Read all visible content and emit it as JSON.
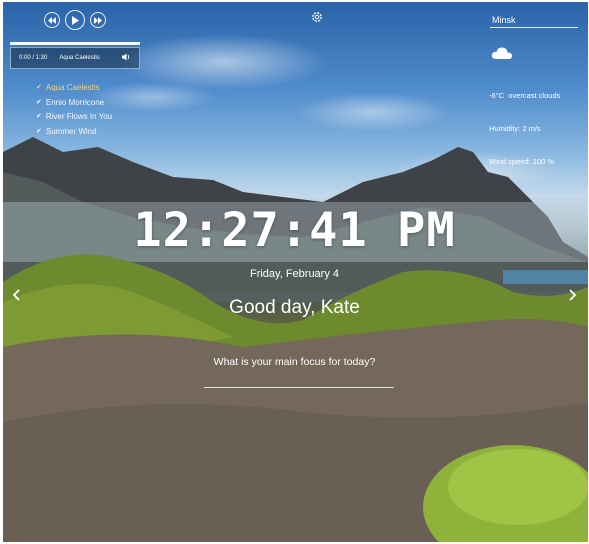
{
  "player": {
    "prev_icon": "skip-back-icon",
    "play_icon": "play-icon",
    "next_icon": "skip-forward-icon",
    "current_time": "0:00 / 1:30",
    "current_track": "Aqua Caelestis",
    "volume_icon": "volume-icon",
    "playlist": [
      {
        "title": "Aqua Caelestis",
        "icon": "play-small-icon"
      },
      {
        "title": "Ennio Morricone",
        "icon": "play-small-icon"
      },
      {
        "title": "River Flows In You",
        "icon": "play-small-icon"
      },
      {
        "title": "Summer Wind",
        "icon": "play-small-icon"
      }
    ]
  },
  "settings": {
    "icon": "gear-icon"
  },
  "weather": {
    "city": "Minsk",
    "icon": "cloud-icon",
    "description": "-6°C  overcast clouds",
    "humidity": "Humidity: 2 m/s",
    "wind": "Wind speed: 100 %"
  },
  "clock": {
    "time": "12:27:41 PM",
    "date": "Friday, February 4"
  },
  "greeting": {
    "text": "Good day,",
    "name": "Kate"
  },
  "focus": {
    "label": "What is your main focus for today?",
    "value": ""
  },
  "slider": {
    "prev_icon": "chevron-left-icon",
    "next_icon": "chevron-right-icon"
  }
}
